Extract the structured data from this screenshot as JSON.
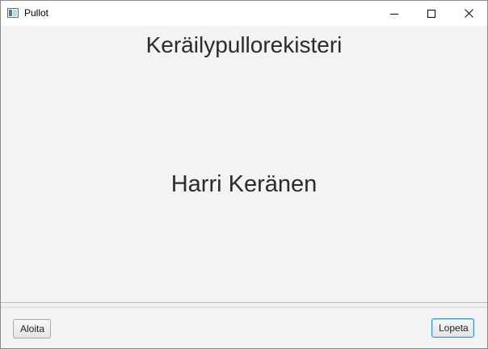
{
  "window": {
    "title": "Pullot",
    "icon": "java-app-icon",
    "controls": [
      "minimize-icon",
      "maximize-icon",
      "close-icon"
    ]
  },
  "main": {
    "heading": "Keräilypullorekisteri",
    "author": "Harri Keränen"
  },
  "buttons": {
    "start_label": "Aloita",
    "quit_label": "Lopeta"
  },
  "colors": {
    "background": "#f3f3f3",
    "text": "#2b2b2b",
    "focus_border": "#3d8fd1"
  }
}
